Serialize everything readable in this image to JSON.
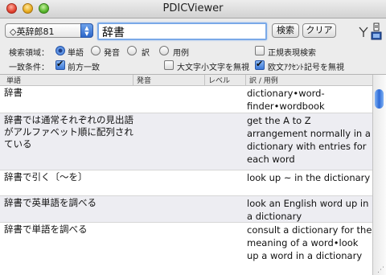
{
  "window": {
    "title": "PDICViewer"
  },
  "toolbar": {
    "dictionary": "◇英辞郎81",
    "query": "辞書",
    "search_label": "検索",
    "clear_label": "クリア"
  },
  "options": {
    "scope_label": "検索領域：",
    "scope_options": [
      "単語",
      "発音",
      "訳",
      "用例"
    ],
    "scope_selected": "単語",
    "regex_label": "正規表現検索",
    "regex_checked": false,
    "match_label": "一致条件：",
    "prefix_label": "前方一致",
    "prefix_checked": true,
    "ignore_case_label": "大文字小文字を無視",
    "ignore_case_checked": false,
    "ignore_accent_label": "欧文ｱｸｾﾝﾄ記号を無視",
    "ignore_accent_checked": true
  },
  "table": {
    "columns": [
      "単語",
      "発音",
      "レベル",
      "訳 / 用例"
    ],
    "rows": [
      {
        "word": "辞書",
        "translation": "dictionary•word-finder•wordbook"
      },
      {
        "word": "辞書では通常それぞれの見出語がアルファベット順に配列されている",
        "translation": "get the A to Z arrangement normally in a dictionary with entries for each word"
      },
      {
        "word": "辞書で引く〔～を〕",
        "translation": "look up ~ in the dictionary"
      },
      {
        "word": "辞書で英単語を調べる",
        "translation": "look an English word up in a dictionary"
      },
      {
        "word": "辞書で単語を調べる",
        "translation": "consult a dictionary for the meaning of a word•look up a word in a dictionary"
      }
    ]
  }
}
